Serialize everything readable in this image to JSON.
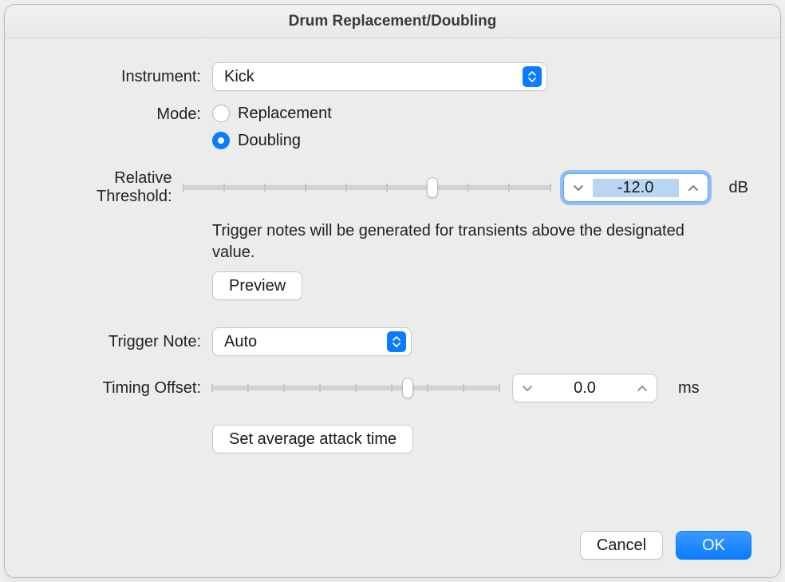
{
  "window": {
    "title": "Drum Replacement/Doubling"
  },
  "instrument": {
    "label": "Instrument:",
    "value": "Kick"
  },
  "mode": {
    "label": "Mode:",
    "options": [
      {
        "label": "Replacement",
        "selected": false
      },
      {
        "label": "Doubling",
        "selected": true
      }
    ]
  },
  "threshold": {
    "label": "Relative Threshold:",
    "value": "-12.0",
    "unit": "dB",
    "slider_percent": 68,
    "help": "Trigger notes will be generated for transients above the designated value."
  },
  "preview": {
    "label": "Preview"
  },
  "trigger_note": {
    "label": "Trigger Note:",
    "value": "Auto"
  },
  "timing_offset": {
    "label": "Timing Offset:",
    "value": "0.0",
    "unit": "ms",
    "slider_percent": 68
  },
  "avg_attack": {
    "label": "Set average attack time"
  },
  "footer": {
    "cancel": "Cancel",
    "ok": "OK"
  }
}
